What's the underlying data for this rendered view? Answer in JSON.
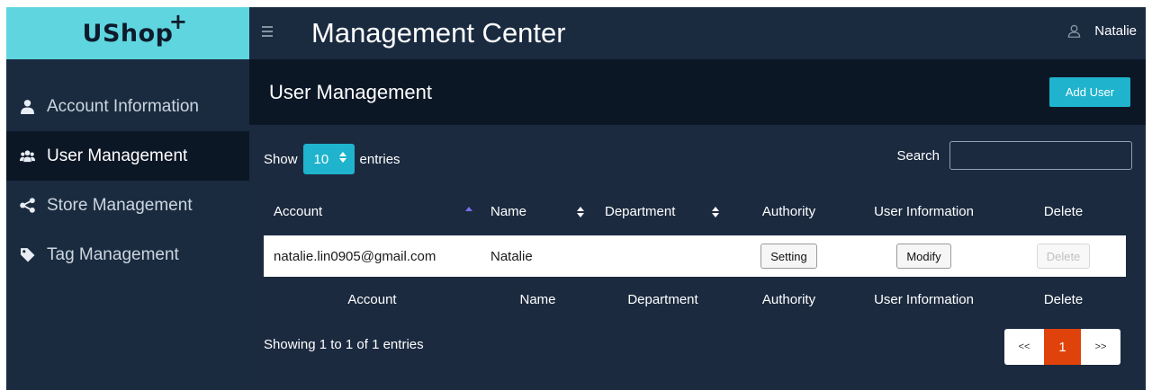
{
  "brand": {
    "name": "UShop",
    "suffix": "+"
  },
  "app": {
    "title": "Management Center"
  },
  "user": {
    "name": "Natalie"
  },
  "sidebar": {
    "items": [
      {
        "label": "Account Information",
        "icon": "user-icon",
        "active": false
      },
      {
        "label": "User Management",
        "icon": "users-icon",
        "active": true
      },
      {
        "label": "Store Management",
        "icon": "share-icon",
        "active": false
      },
      {
        "label": "Tag Management",
        "icon": "tag-icon",
        "active": false
      }
    ]
  },
  "page": {
    "title": "User Management",
    "add_button": "Add User"
  },
  "table_controls": {
    "show_label": "Show",
    "entries_value": "10",
    "entries_label": "entries",
    "search_label": "Search",
    "search_value": ""
  },
  "table": {
    "headers": [
      "Account",
      "Name",
      "Department",
      "Authority",
      "User Information",
      "Delete"
    ],
    "rows": [
      {
        "account": "natalie.lin0905@gmail.com",
        "name": "Natalie",
        "department": "",
        "authority_button": "Setting",
        "info_button": "Modify",
        "delete_button": "Delete"
      }
    ]
  },
  "footer": {
    "info": "Showing 1 to 1 of 1 entries",
    "prev": "<<",
    "current_page": "1",
    "next": ">>"
  },
  "colors": {
    "brand_bg": "#5fd6df",
    "sidebar_bg": "#1a2b40",
    "active_bg": "#0c1726",
    "accent": "#1fb3cd",
    "page_active": "#e0420b"
  }
}
